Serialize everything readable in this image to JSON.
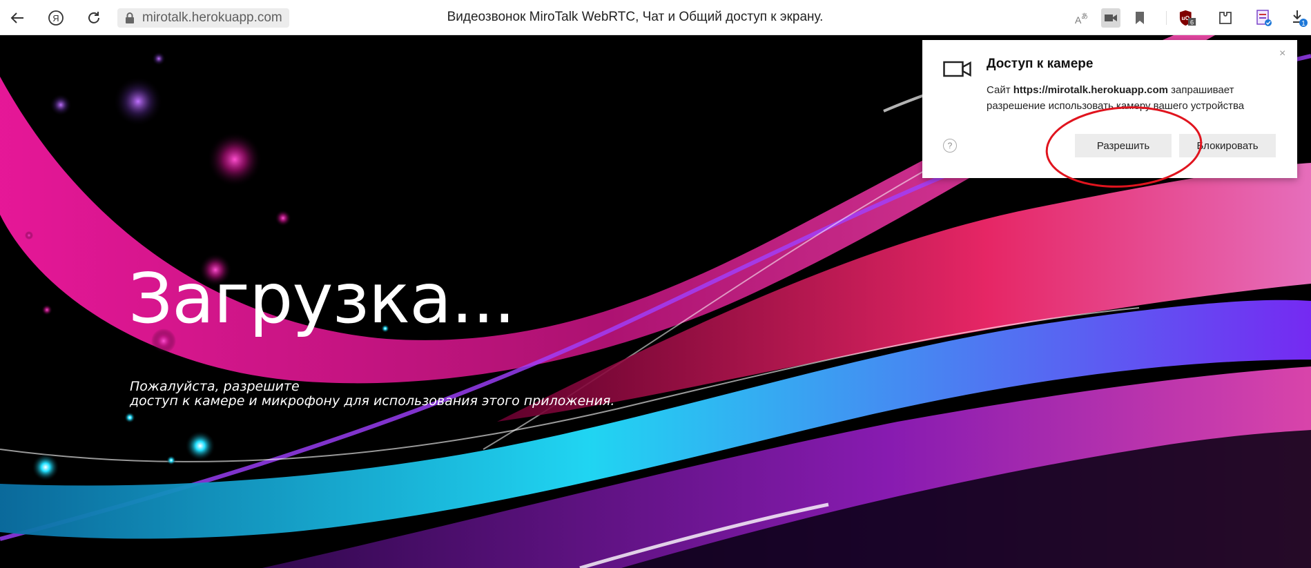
{
  "browser": {
    "address": "mirotalk.herokuapp.com",
    "title": "Видеозвонок MiroTalk WebRTC, Чат и Общий доступ к экрану.",
    "ublock_count": "6",
    "downloads_badge": "1",
    "icons": [
      "back-icon",
      "yandex-icon",
      "reload-icon",
      "lock-icon",
      "translate-icon",
      "camera-icon",
      "bookmark-icon",
      "ublock-icon",
      "extension-icon",
      "clipboard-icon",
      "download-icon"
    ]
  },
  "page": {
    "loading_title": "Загрузка...",
    "message_line1": "Пожалуйста, разрешите",
    "message_line2": "доступ к камере и микрофону для использования этого приложения."
  },
  "popup": {
    "title": "Доступ к камере",
    "text_before": "Сайт ",
    "site": "https://mirotalk.herokuapp.com",
    "text_after": " запрашивает разрешение использовать камеру вашего устройства",
    "help": "?",
    "allow_label": "Разрешить",
    "block_label": "Блокировать",
    "close": "×"
  },
  "colors": {
    "annotation": "#e0141e",
    "magenta": "#e0208f",
    "cyan": "#22e0ff"
  }
}
